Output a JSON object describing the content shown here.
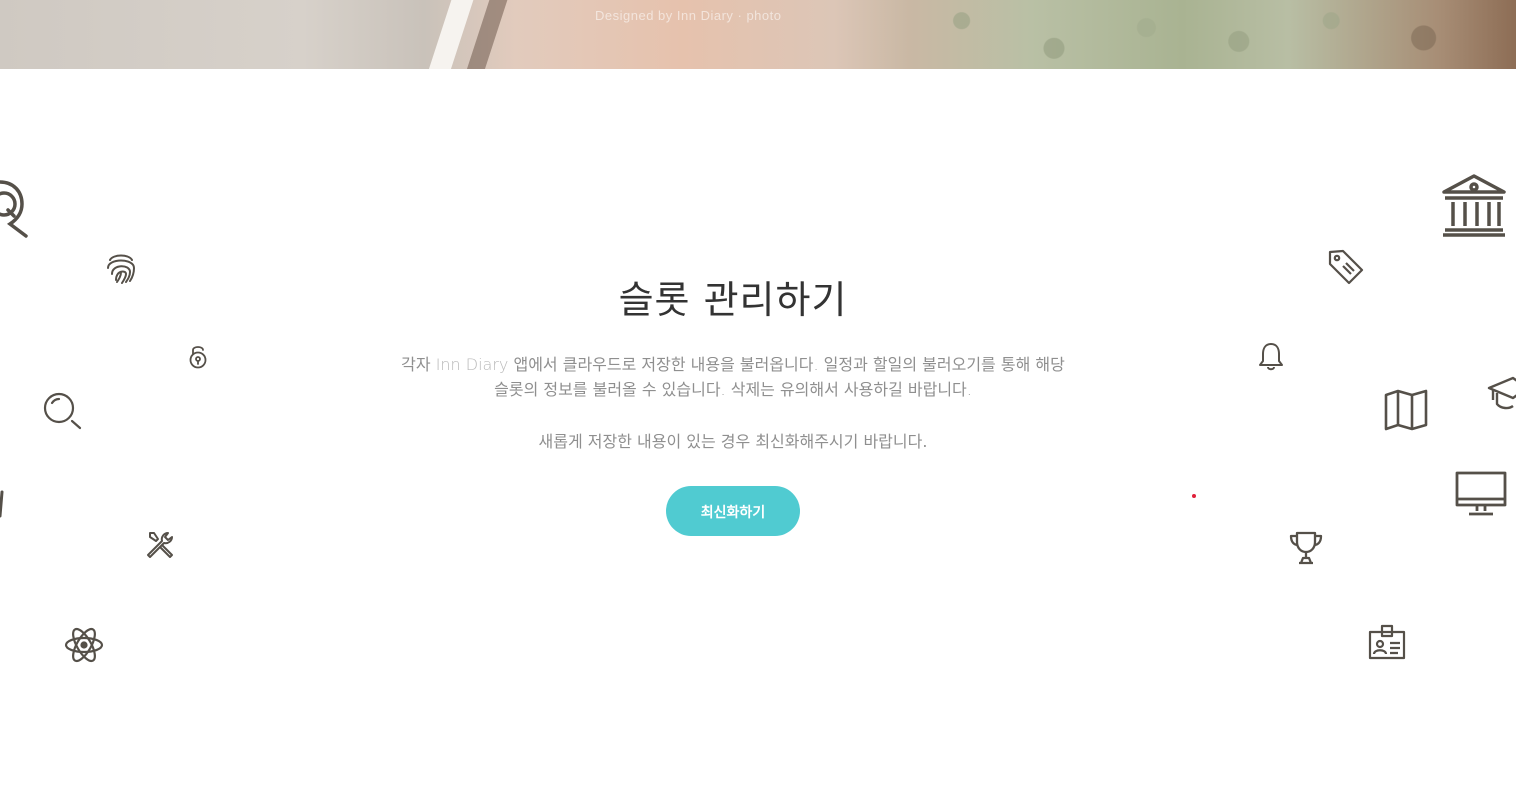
{
  "hero": {
    "caption": "Designed by Inn Diary · photo"
  },
  "main": {
    "title": "슬롯 관리하기",
    "description_before": "각자 ",
    "description_brand": "Inn Diary",
    "description_after": " 앱에서 클라우드로 저장한 내용을 불러옵니다. 일정과 할일의 불러오기를 통해 해당 슬롯의 정보를 불러올 수 있습니다. 삭제는 유의해서 사용하길 바랍니다.",
    "note": "새롭게 저장한 내용이 있는 경우 최신화해주시기 바랍니다.",
    "refresh_button": "최신화하기"
  },
  "colors": {
    "accent": "#50cbd1",
    "icon": "#555049",
    "title": "#333333",
    "body_text": "#8f8f8f"
  },
  "icons": {
    "left": [
      "chat-search-icon",
      "fingerprint-icon",
      "unlock-icon",
      "magnifier-icon",
      "partial-icon",
      "tools-icon",
      "atom-icon"
    ],
    "right": [
      "bank-icon",
      "price-tag-icon",
      "bell-icon",
      "map-icon",
      "graduation-cap-icon",
      "monitor-icon",
      "trophy-icon",
      "id-card-icon"
    ]
  }
}
